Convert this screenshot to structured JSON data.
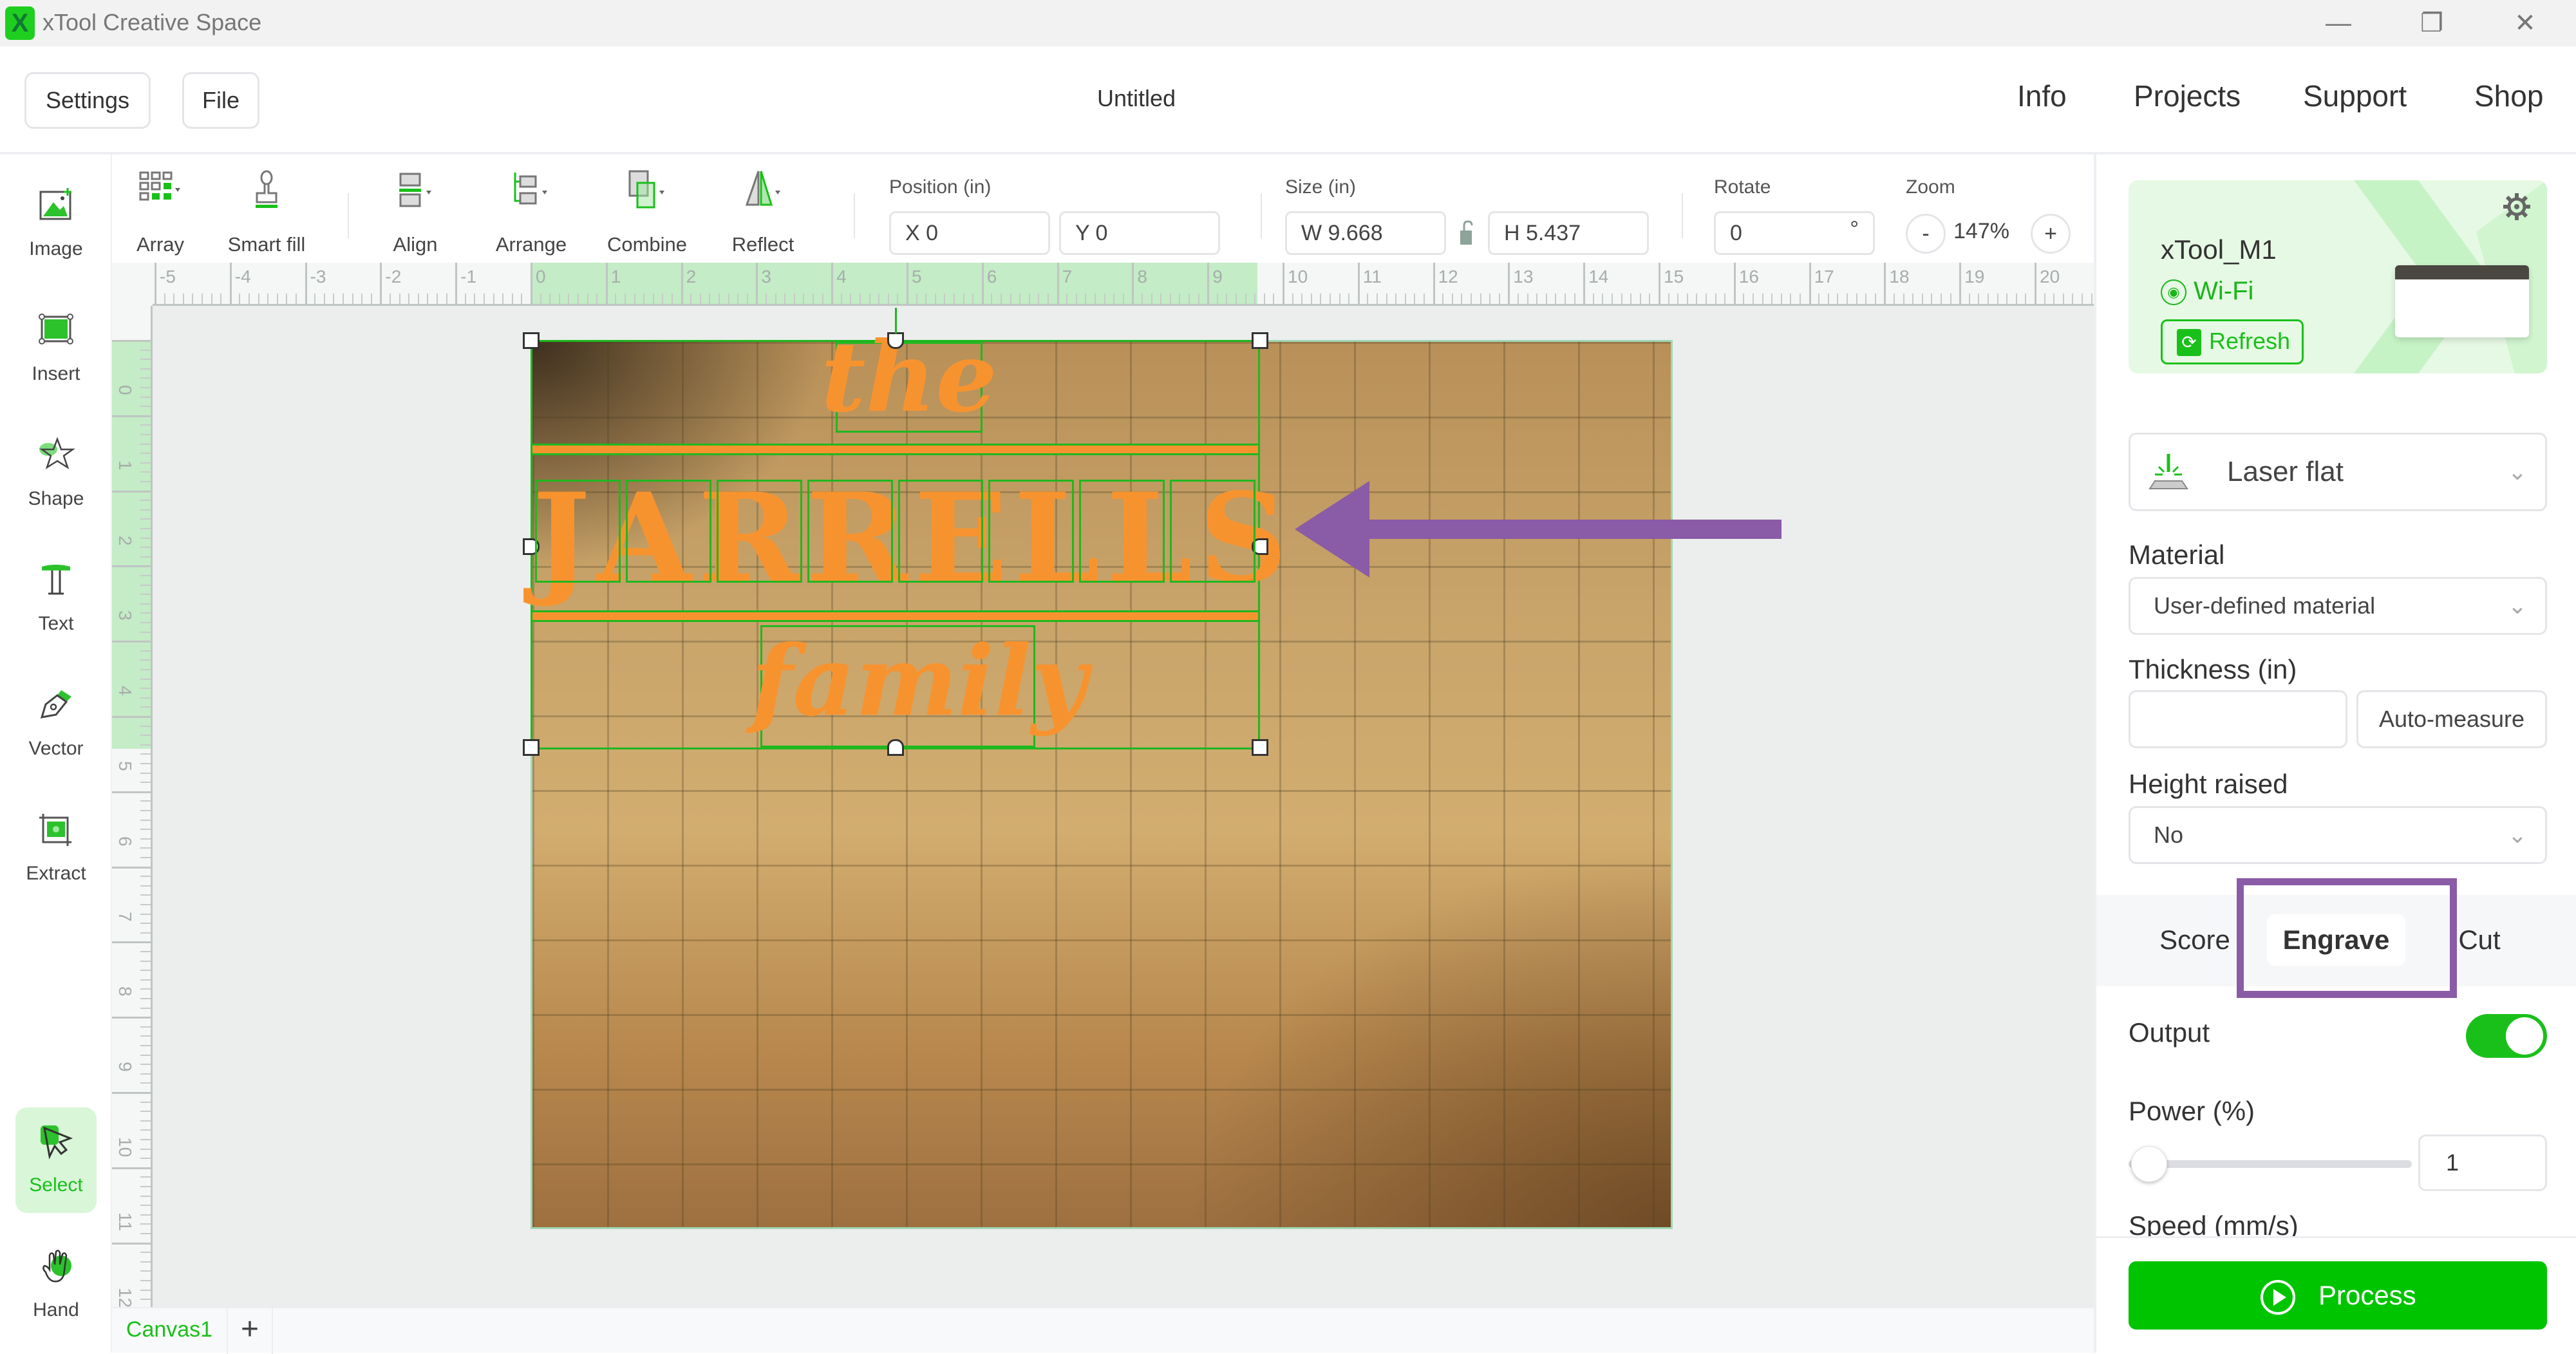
{
  "app": {
    "title": "xTool Creative Space",
    "logo_letter": "X",
    "window_controls": {
      "minimize": "—",
      "restore": "❐",
      "close": "✕"
    }
  },
  "header": {
    "settings_label": "Settings",
    "file_label": "File",
    "doc_title": "Untitled",
    "nav": [
      "Info",
      "Projects",
      "Support",
      "Shop"
    ]
  },
  "left_tools": [
    {
      "label": "Image",
      "icon": "image-icon"
    },
    {
      "label": "Insert",
      "icon": "insert-icon"
    },
    {
      "label": "Shape",
      "icon": "shape-icon"
    },
    {
      "label": "Text",
      "icon": "text-icon"
    },
    {
      "label": "Vector",
      "icon": "vector-pen-icon"
    },
    {
      "label": "Extract",
      "icon": "extract-icon"
    },
    {
      "label": "Select",
      "icon": "select-cursor-icon",
      "active": true
    },
    {
      "label": "Hand",
      "icon": "hand-icon"
    }
  ],
  "toolbar": {
    "items": [
      {
        "label": "Array",
        "icon": "array-icon"
      },
      {
        "label": "Smart fill",
        "icon": "smart-fill-icon"
      },
      {
        "label": "Align",
        "icon": "align-icon"
      },
      {
        "label": "Arrange",
        "icon": "arrange-icon"
      },
      {
        "label": "Combine",
        "icon": "combine-icon"
      },
      {
        "label": "Reflect",
        "icon": "reflect-icon"
      }
    ],
    "position_label": "Position (in)",
    "x_value": "X 0",
    "y_value": "Y 0",
    "size_label": "Size (in)",
    "w_value": "W 9.668",
    "h_value": "H 5.437",
    "rotate_label": "Rotate",
    "rotate_value": "0",
    "rotate_unit": "°",
    "zoom_label": "Zoom",
    "zoom_value": "147%",
    "zoom_minus": "-",
    "zoom_plus": "+"
  },
  "rulers": {
    "horizontal": [
      "-5",
      "-4",
      "-3",
      "-2",
      "-1",
      "0",
      "1",
      "2",
      "3",
      "4",
      "5",
      "6",
      "7",
      "8",
      "9",
      "10",
      "11",
      "12",
      "13",
      "14",
      "15",
      "16",
      "17",
      "18",
      "19",
      "20"
    ],
    "vertical": [
      "0",
      "1",
      "2",
      "3",
      "4",
      "5",
      "6",
      "7",
      "8",
      "9",
      "10",
      "11",
      "12"
    ]
  },
  "design": {
    "top_text": "the",
    "main_text": "JARRELLS",
    "bottom_text": "family",
    "fill_color": "#f7932f",
    "selection_color": "#1fb81f"
  },
  "annotations": {
    "arrow_color": "#8a5ba6",
    "highlight_color": "#8a5ba6"
  },
  "canvas_tabs": {
    "tabs": [
      "Canvas1"
    ],
    "add_label": "+"
  },
  "right_panel": {
    "device": {
      "name": "xTool_M1",
      "connection": "Wi-Fi",
      "refresh_label": "Refresh"
    },
    "processing_type": "Laser flat",
    "material_label": "Material",
    "material_value": "User-defined material",
    "thickness_label": "Thickness (in)",
    "thickness_value": "",
    "auto_measure_label": "Auto-measure",
    "height_raised_label": "Height raised",
    "height_raised_value": "No",
    "mode_tabs": [
      {
        "label": "Score",
        "active": false
      },
      {
        "label": "Engrave",
        "active": true
      },
      {
        "label": "Cut",
        "active": false
      }
    ],
    "output_label": "Output",
    "output_enabled": true,
    "power_label": "Power (%)",
    "power_value": "1",
    "power_slider_fraction": 0.01,
    "speed_label": "Speed (mm/s)",
    "process_label": "Process",
    "accent_color": "#00c400"
  }
}
